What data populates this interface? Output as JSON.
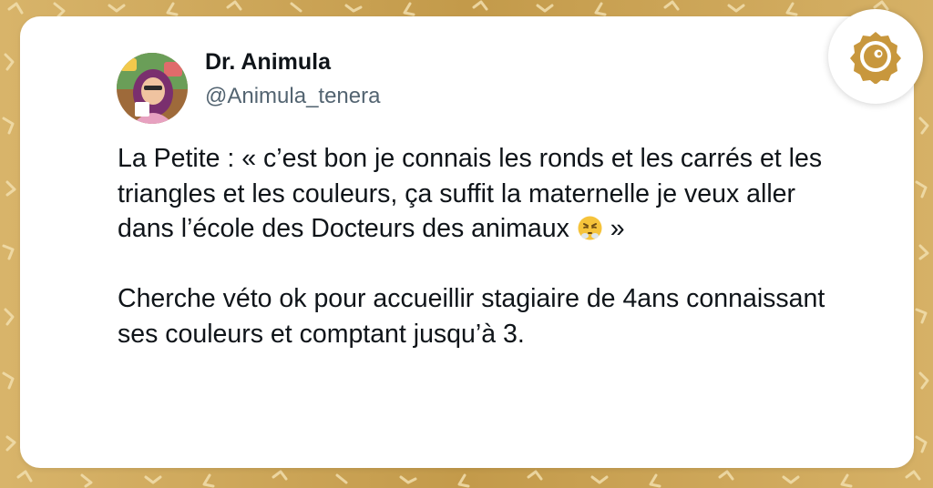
{
  "tweet": {
    "author_name": "Dr. Animula",
    "author_handle": "@Animula_tenera",
    "paragraph1_before_emoji": "La Petite : « c’est bon je connais les ronds et les carrés et les triangles et les couleurs, ça suffit la maternelle je veux aller dans l’école des Docteurs des animaux",
    "emoji": "face-with-steam-from-nose",
    "paragraph1_after_emoji": "»",
    "paragraph2": "Cherche véto ok pour accueillir stagiaire de 4ans connaissant ses couleurs et comptant jusqu’à 3."
  },
  "badge": {
    "icon": "brand-logo-icon",
    "color": "#c8973d"
  },
  "colors": {
    "background": "#cfa75a",
    "pattern": "#f2dfae",
    "card": "#ffffff",
    "text": "#0f1419",
    "muted": "#536471"
  }
}
